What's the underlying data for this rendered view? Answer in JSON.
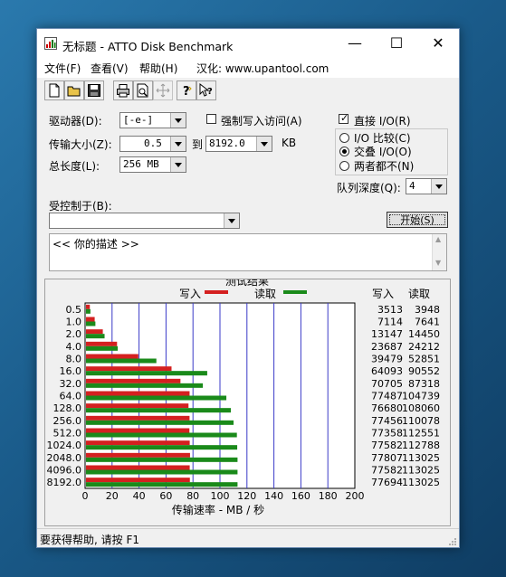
{
  "window": {
    "title": "无标题 - ATTO Disk Benchmark"
  },
  "titlebar_buttons": {
    "minimize": "—",
    "maximize": "☐",
    "close": "✕"
  },
  "menu": {
    "file": "文件(F)",
    "view": "查看(V)",
    "help": "帮助(H)",
    "localized": "汉化: www.upantool.com"
  },
  "toolbar": {
    "icons": [
      "new-file-icon",
      "open-folder-icon",
      "save-icon",
      "print-icon",
      "print-preview-icon",
      "move-icon",
      "help-icon",
      "context-help-icon"
    ]
  },
  "form": {
    "drive_label": "驱动器(D):",
    "drive_value": "[-e-]",
    "force_write_label": "强制写入访问(A)",
    "force_write_checked": false,
    "direct_io_label": "直接 I/O(R)",
    "direct_io_checked": true,
    "transfer_size_label": "传输大小(Z):",
    "transfer_from": "0.5",
    "to_label": "到",
    "transfer_to": "8192.0",
    "kb_label": "KB",
    "total_length_label": "总长度(L):",
    "total_length_value": "256 MB",
    "io_compare_label": "I/O 比较(C)",
    "overlap_io_label": "交叠 I/O(O)",
    "neither_label": "两者都不(N)",
    "selected_radio": "overlap",
    "queue_depth_label": "队列深度(Q):",
    "queue_depth_value": "4",
    "controlled_by_label": "受控制于(B):",
    "controlled_by_value": "",
    "start_button": "开始(S)",
    "description_text": "<<  你的描述   >>"
  },
  "results": {
    "title": "测试结果",
    "legend_write": "写入",
    "legend_read": "读取",
    "col_write": "写入",
    "col_read": "读取",
    "write_color": "#d42020",
    "read_color": "#1a8a1a",
    "grid_color": "#3a3ac8"
  },
  "chart_data": {
    "type": "bar",
    "orientation": "horizontal",
    "title": "测试结果",
    "xlabel": "传输速率 - MB / 秒",
    "xlim": [
      0,
      200
    ],
    "xticks": [
      0,
      20,
      40,
      60,
      80,
      100,
      120,
      140,
      160,
      180,
      200
    ],
    "categories": [
      "0.5",
      "1.0",
      "2.0",
      "4.0",
      "8.0",
      "16.0",
      "32.0",
      "64.0",
      "128.0",
      "256.0",
      "512.0",
      "1024.0",
      "2048.0",
      "4096.0",
      "8192.0"
    ],
    "series": [
      {
        "name": "写入",
        "values": [
          3513,
          7114,
          13147,
          23687,
          39479,
          64093,
          70705,
          77487,
          76680,
          77456,
          77358,
          77582,
          77807,
          77582,
          77694
        ]
      },
      {
        "name": "读取",
        "values": [
          3948,
          7641,
          14450,
          24212,
          52851,
          90552,
          87318,
          104739,
          108060,
          110078,
          112551,
          112788,
          113025,
          113025,
          113025
        ]
      }
    ],
    "value_unit_divisor": 1000
  },
  "statusbar": {
    "text": "要获得帮助, 请按 F1"
  }
}
